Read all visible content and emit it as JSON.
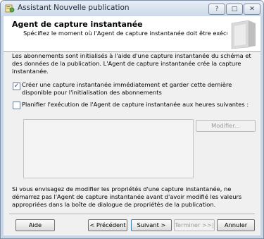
{
  "window": {
    "title": "Assistant Nouvelle publication",
    "controls": {
      "help": "?",
      "maximize": "□",
      "close": "✕"
    }
  },
  "header": {
    "title": "Agent de capture instantanée",
    "subtitle": "Spécifiez le moment où l'Agent de capture instantanée doit être exécuté."
  },
  "body": {
    "intro": "Les abonnements sont initialisés à l'aide d'une capture instantanée du schéma et des données de la publication. L'Agent de capture instantanée crée la capture instantanée.",
    "option_immediate": {
      "label": "Créer une capture instantanée immédiatement et garder cette dernière disponible pour l'initialisation des abonnements",
      "checked": true,
      "mark": "✓"
    },
    "option_schedule": {
      "label": "Planifier l'exécution de l'Agent de capture instantanée aux heures suivantes :",
      "checked": false
    },
    "modify_button": "Modifier...",
    "note": "Si vous envisagez de modifier les propriétés d'une capture instantanée, ne démarrez pas l'Agent de capture instantanée avant d'avoir modifié les valeurs appropriées dans la boîte de dialogue de propriétés de la publication."
  },
  "footer": {
    "help": "Aide",
    "previous": "< Précédent",
    "next": "Suivant >",
    "finish": "Terminer >>|",
    "cancel": "Annuler"
  }
}
